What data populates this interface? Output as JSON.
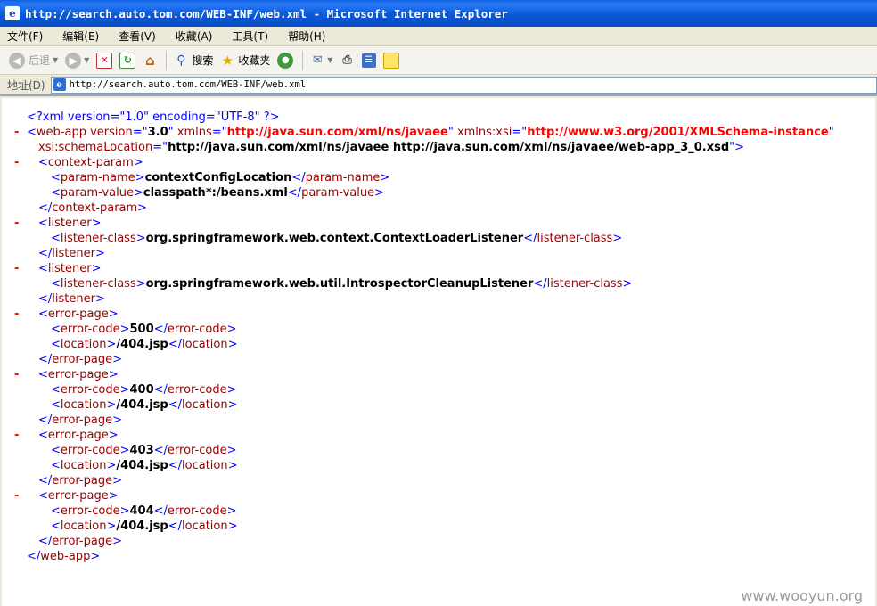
{
  "window": {
    "title": "http://search.auto.tom.com/WEB-INF/web.xml - Microsoft Internet Explorer",
    "icon": "ie-page-icon"
  },
  "menu": [
    "文件(F)",
    "编辑(E)",
    "查看(V)",
    "收藏(A)",
    "工具(T)",
    "帮助(H)"
  ],
  "toolbar": {
    "back": "后退",
    "search": "搜索",
    "favorites": "收藏夹"
  },
  "address": {
    "label": "地址(D)",
    "url": "http://search.auto.tom.com/WEB-INF/web.xml"
  },
  "xml": {
    "decl": "<?xml version=\"1.0\" encoding=\"UTF-8\" ?>",
    "webapp": {
      "open_tag": "web-app",
      "version_attr": "version",
      "version": "3.0",
      "xmlns_attr": "xmlns",
      "xmlns": "http://java.sun.com/xml/ns/javaee",
      "xmlns_xsi_attr": "xmlns:xsi",
      "xmlns_xsi": "http://www.w3.org/2001/XMLSchema-instance",
      "schema_attr": "xsi:schemaLocation",
      "schema": "http://java.sun.com/xml/ns/javaee http://java.sun.com/xml/ns/javaee/web-app_3_0.xsd"
    },
    "context_param": {
      "tag": "context-param",
      "name_tag": "param-name",
      "name": "contextConfigLocation",
      "value_tag": "param-value",
      "value": "classpath*:/beans.xml"
    },
    "listeners": [
      {
        "tag": "listener",
        "class_tag": "listener-class",
        "class": "org.springframework.web.context.ContextLoaderListener"
      },
      {
        "tag": "listener",
        "class_tag": "listener-class",
        "class": "org.springframework.web.util.IntrospectorCleanupListener"
      }
    ],
    "error_pages": [
      {
        "tag": "error-page",
        "code_tag": "error-code",
        "code": "500",
        "loc_tag": "location",
        "location": "/404.jsp"
      },
      {
        "tag": "error-page",
        "code_tag": "error-code",
        "code": "400",
        "loc_tag": "location",
        "location": "/404.jsp"
      },
      {
        "tag": "error-page",
        "code_tag": "error-code",
        "code": "403",
        "loc_tag": "location",
        "location": "/404.jsp"
      },
      {
        "tag": "error-page",
        "code_tag": "error-code",
        "code": "404",
        "loc_tag": "location",
        "location": "/404.jsp"
      }
    ],
    "close_webapp": "web-app",
    "collapse_marker": "-"
  },
  "watermark": "www.wooyun.org",
  "colors": {
    "markup": "#0000ff",
    "tag_name": "#990000",
    "namespace_value": "#ff0000",
    "collapse": "#ff0000"
  }
}
